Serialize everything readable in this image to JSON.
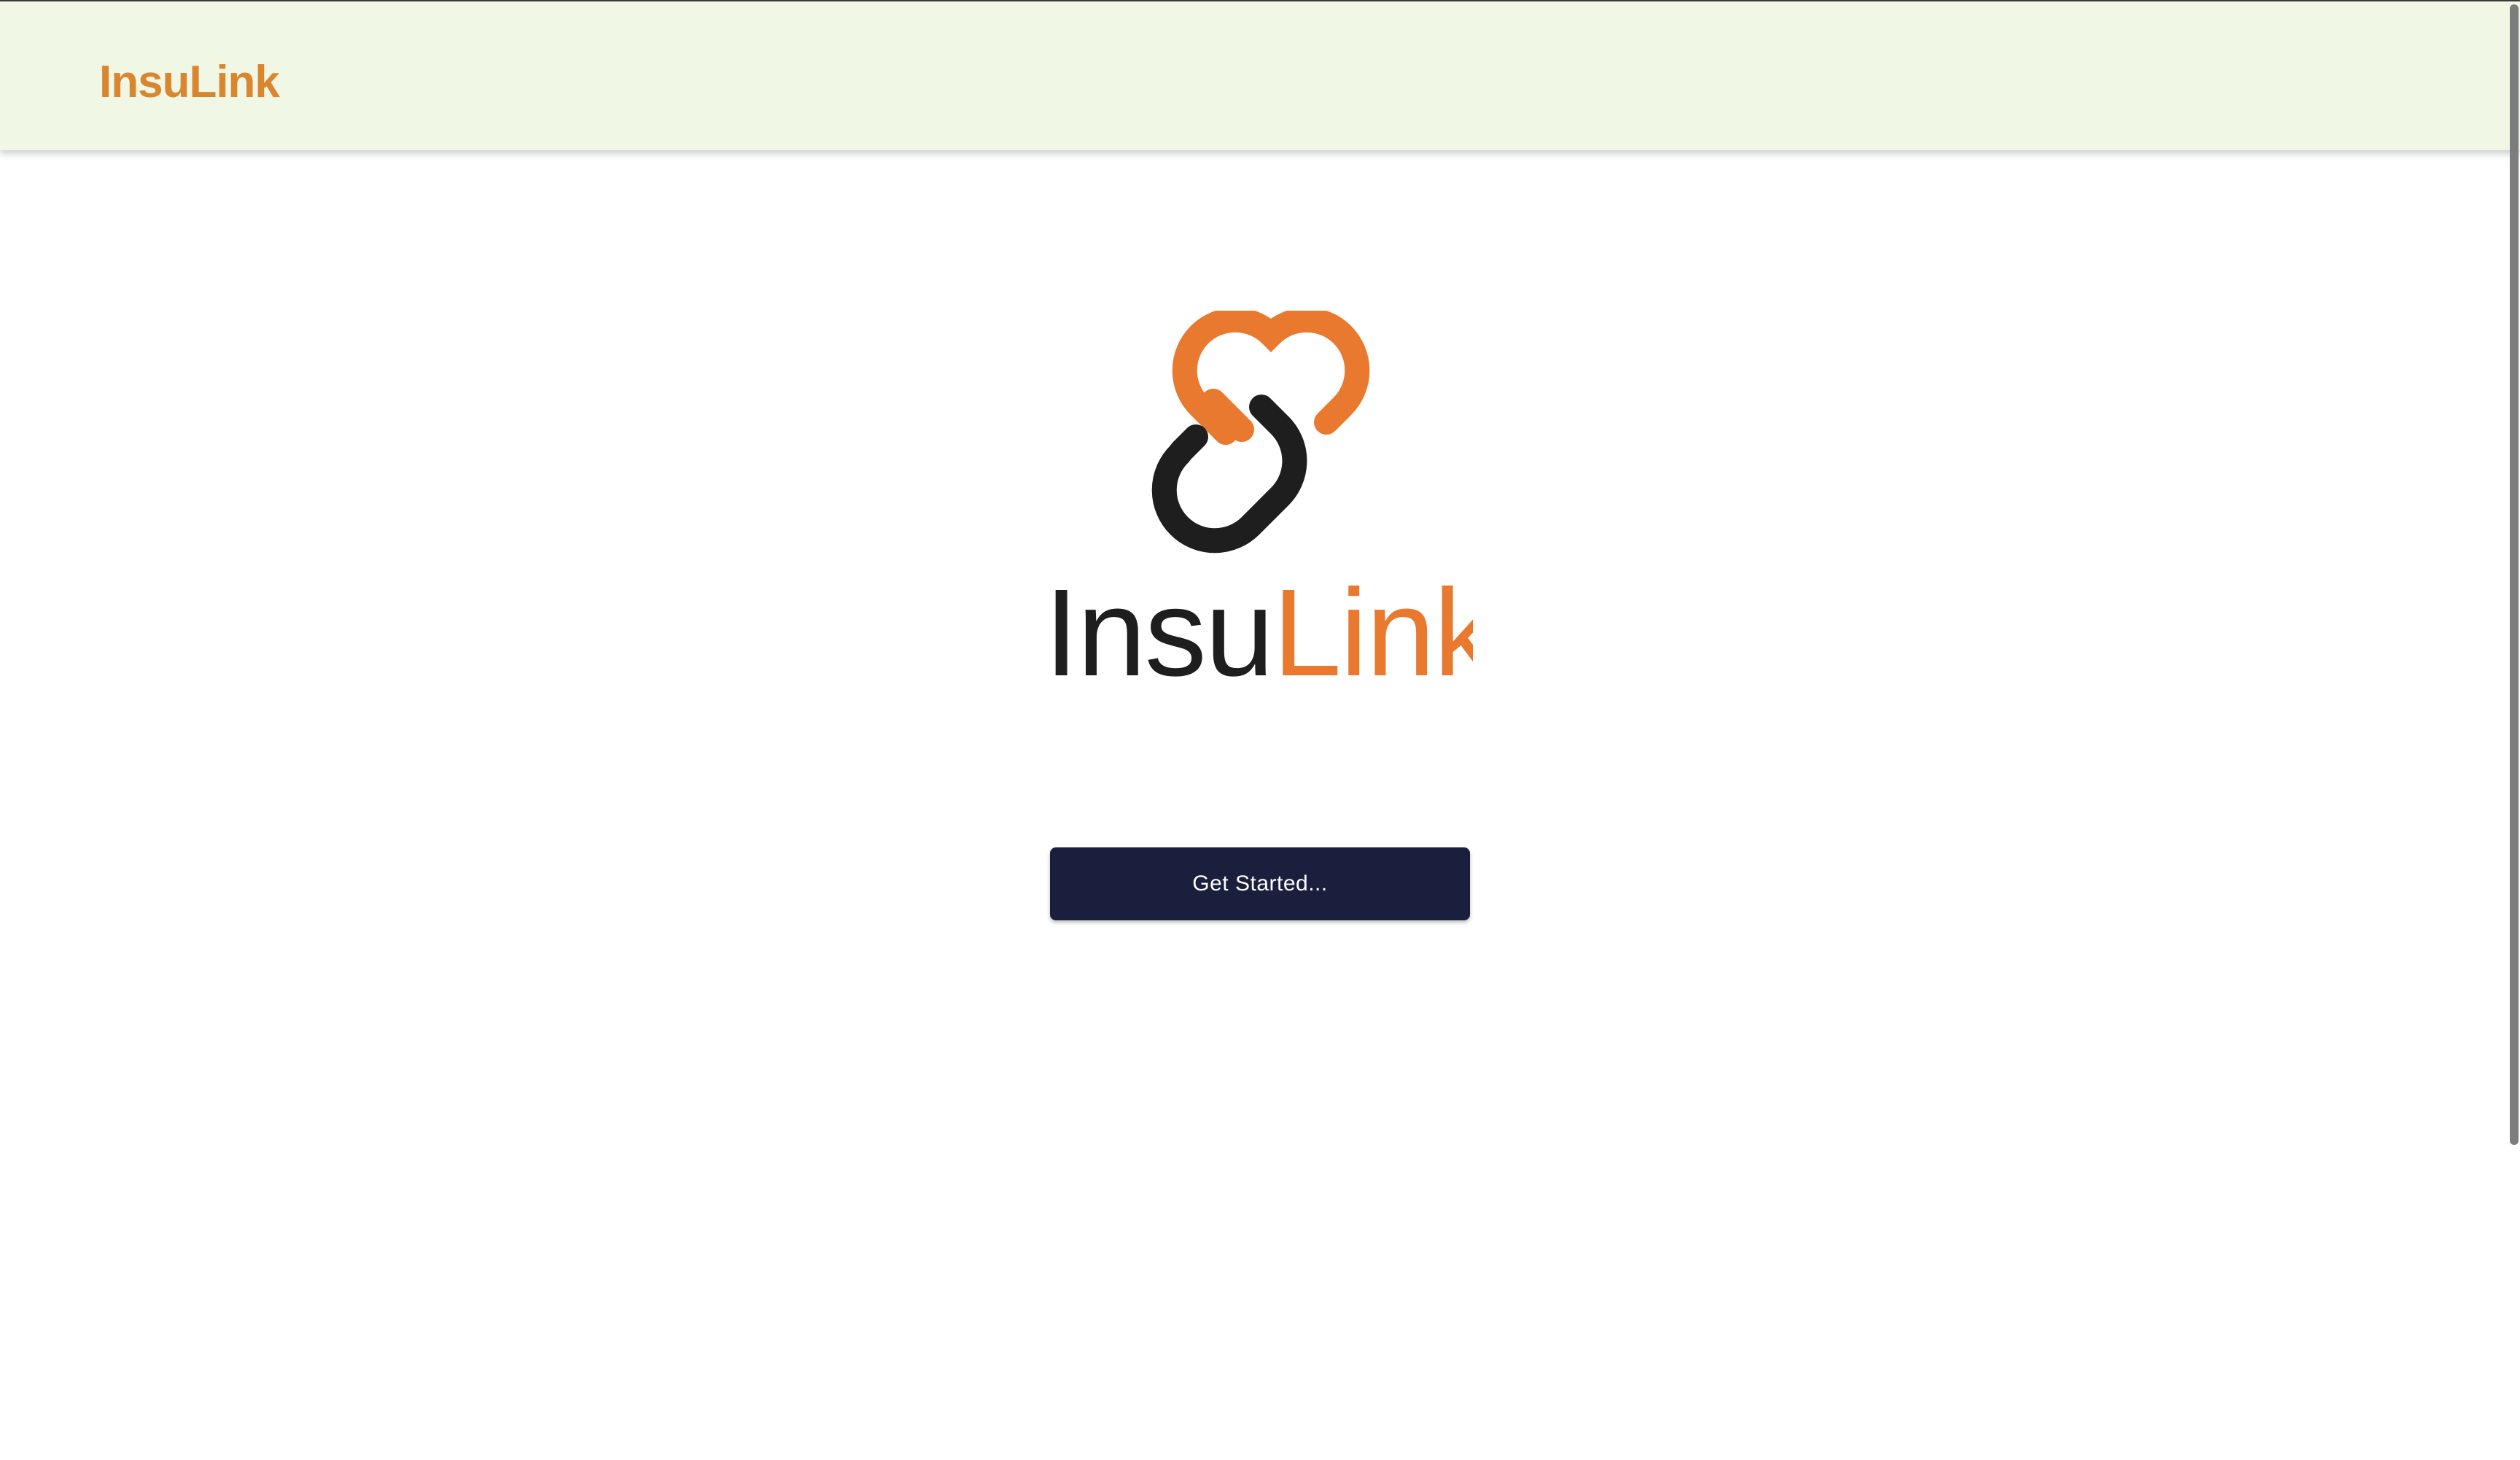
{
  "header": {
    "brand": "InsuLink"
  },
  "logo": {
    "text_dark": "Insu",
    "text_accent": "Link"
  },
  "hero": {
    "cta_label": "Get Started..."
  },
  "colors": {
    "header_bg": "#f0f7e4",
    "brand_orange": "#e8792f",
    "header_brand_text": "#d9862f",
    "logo_dark": "#1e1e1e",
    "cta_bg": "#1a1f3e",
    "cta_text": "#ffffff"
  },
  "icons": {
    "logo_mark": "chain-link-icon"
  }
}
